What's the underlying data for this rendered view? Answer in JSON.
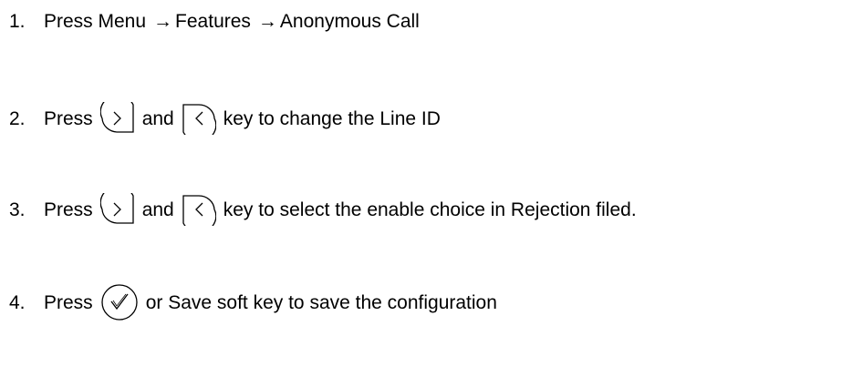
{
  "steps": [
    {
      "number": "1.",
      "text_press": "Press Menu",
      "arrow": "→",
      "features": "Features",
      "anonymous_call": "Anonymous Call"
    },
    {
      "number": "2.",
      "text_press": "Press",
      "text_and": "and",
      "text_after": "key to change the Line ID",
      "key_right_icon": "right-arrow-key-icon",
      "key_left_icon": "left-arrow-key-icon"
    },
    {
      "number": "3.",
      "text_press": "Press",
      "text_and": "and",
      "text_after": "key to select the enable choice in Rejection filed.",
      "key_right_icon": "right-arrow-key-icon",
      "key_left_icon": "left-arrow-key-icon"
    },
    {
      "number": "4.",
      "text_press": "Press",
      "text_after": "or Save soft key to save the configuration",
      "key_ok_icon": "ok-checkmark-key-icon"
    }
  ]
}
